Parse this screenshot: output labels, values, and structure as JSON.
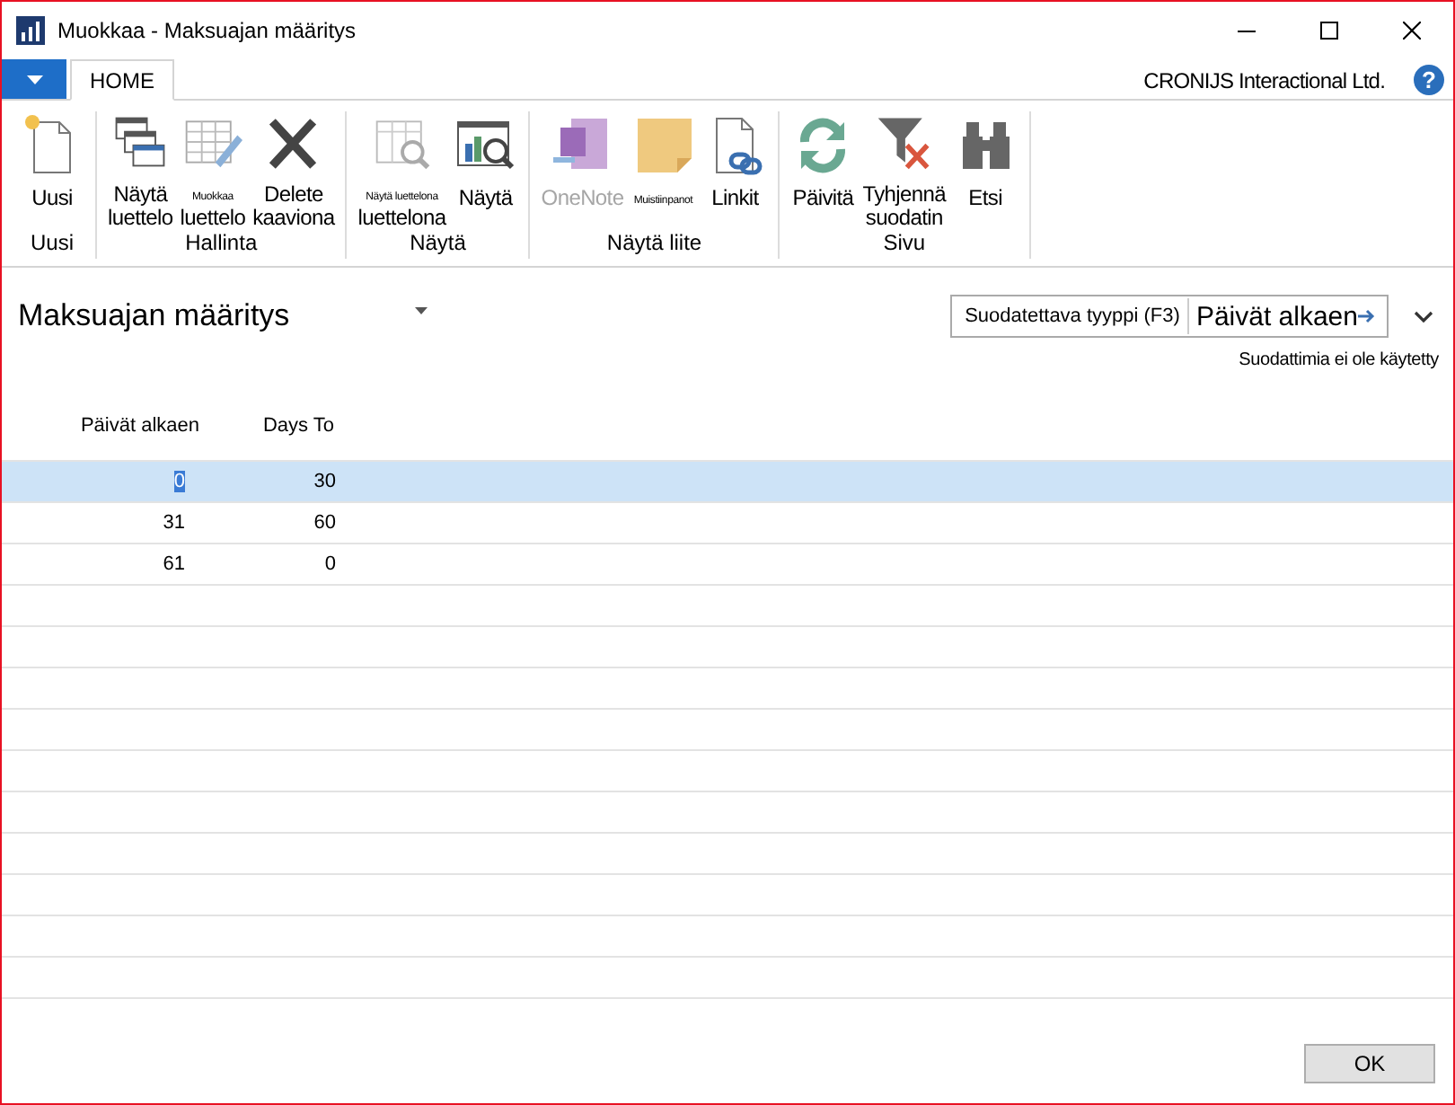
{
  "window": {
    "title": "Muokkaa - Maksuajan määritys"
  },
  "tabs": [
    {
      "label": "HOME",
      "selected": true
    }
  ],
  "company": "CRONIJS Interactional Ltd.",
  "help": "?",
  "ribbon": {
    "groups": [
      {
        "label": "Uusi",
        "buttons": [
          {
            "lines": [
              {
                "text": "Uusi",
                "kind": "normal"
              }
            ],
            "disabled": false
          }
        ]
      },
      {
        "label": "Hallinta",
        "buttons": [
          {
            "lines": [
              {
                "text": "Näytä",
                "kind": "normal"
              },
              {
                "text": "luettelo",
                "kind": "normal"
              }
            ],
            "disabled": false
          },
          {
            "lines": [
              {
                "text": "Muokkaa",
                "kind": "tiny"
              },
              {
                "text": "luettelo",
                "kind": "normal"
              }
            ],
            "disabled": false
          },
          {
            "lines": [
              {
                "text": "Delete",
                "kind": "normal"
              },
              {
                "text": "kaaviona",
                "kind": "normal"
              }
            ],
            "disabled": false
          }
        ]
      },
      {
        "label": "Näytä",
        "buttons": [
          {
            "lines": [
              {
                "text": "Näytä luettelona",
                "kind": "tiny"
              },
              {
                "text": "luettelona",
                "kind": "normal"
              }
            ],
            "disabled": false
          },
          {
            "lines": [
              {
                "text": "Näytä",
                "kind": "normal"
              }
            ],
            "disabled": false
          }
        ]
      },
      {
        "label": "Näytä liite",
        "buttons": [
          {
            "lines": [
              {
                "text": "OneNote",
                "kind": "normal"
              }
            ],
            "disabled": true
          },
          {
            "lines": [
              {
                "text": "Muistiinpanot",
                "kind": "tiny"
              }
            ],
            "disabled": false
          },
          {
            "lines": [
              {
                "text": "Linkit",
                "kind": "normal"
              }
            ],
            "disabled": false
          }
        ]
      },
      {
        "label": "Sivu",
        "buttons": [
          {
            "lines": [
              {
                "text": "Päivitä",
                "kind": "normal"
              }
            ],
            "disabled": false
          },
          {
            "lines": [
              {
                "text": "Tyhjennä",
                "kind": "normal"
              },
              {
                "text": "suodatin",
                "kind": "normal"
              }
            ],
            "disabled": false
          },
          {
            "lines": [
              {
                "text": "Etsi",
                "kind": "normal"
              }
            ],
            "disabled": false
          }
        ]
      }
    ]
  },
  "page": {
    "title": "Maksuajan määritys",
    "filter": {
      "label": "Suodatettava tyyppi (F3)",
      "value": "Päivät alkaen"
    },
    "filter_status": "Suodattimia ei ole käytetty"
  },
  "table": {
    "columns": [
      "Päivät alkaen",
      "Days To"
    ],
    "rows": [
      {
        "cells": [
          "0",
          "30"
        ],
        "selected": true
      },
      {
        "cells": [
          "31",
          "60"
        ],
        "selected": false
      },
      {
        "cells": [
          "61",
          "0"
        ],
        "selected": false
      }
    ]
  },
  "buttons": [
    "OK"
  ]
}
